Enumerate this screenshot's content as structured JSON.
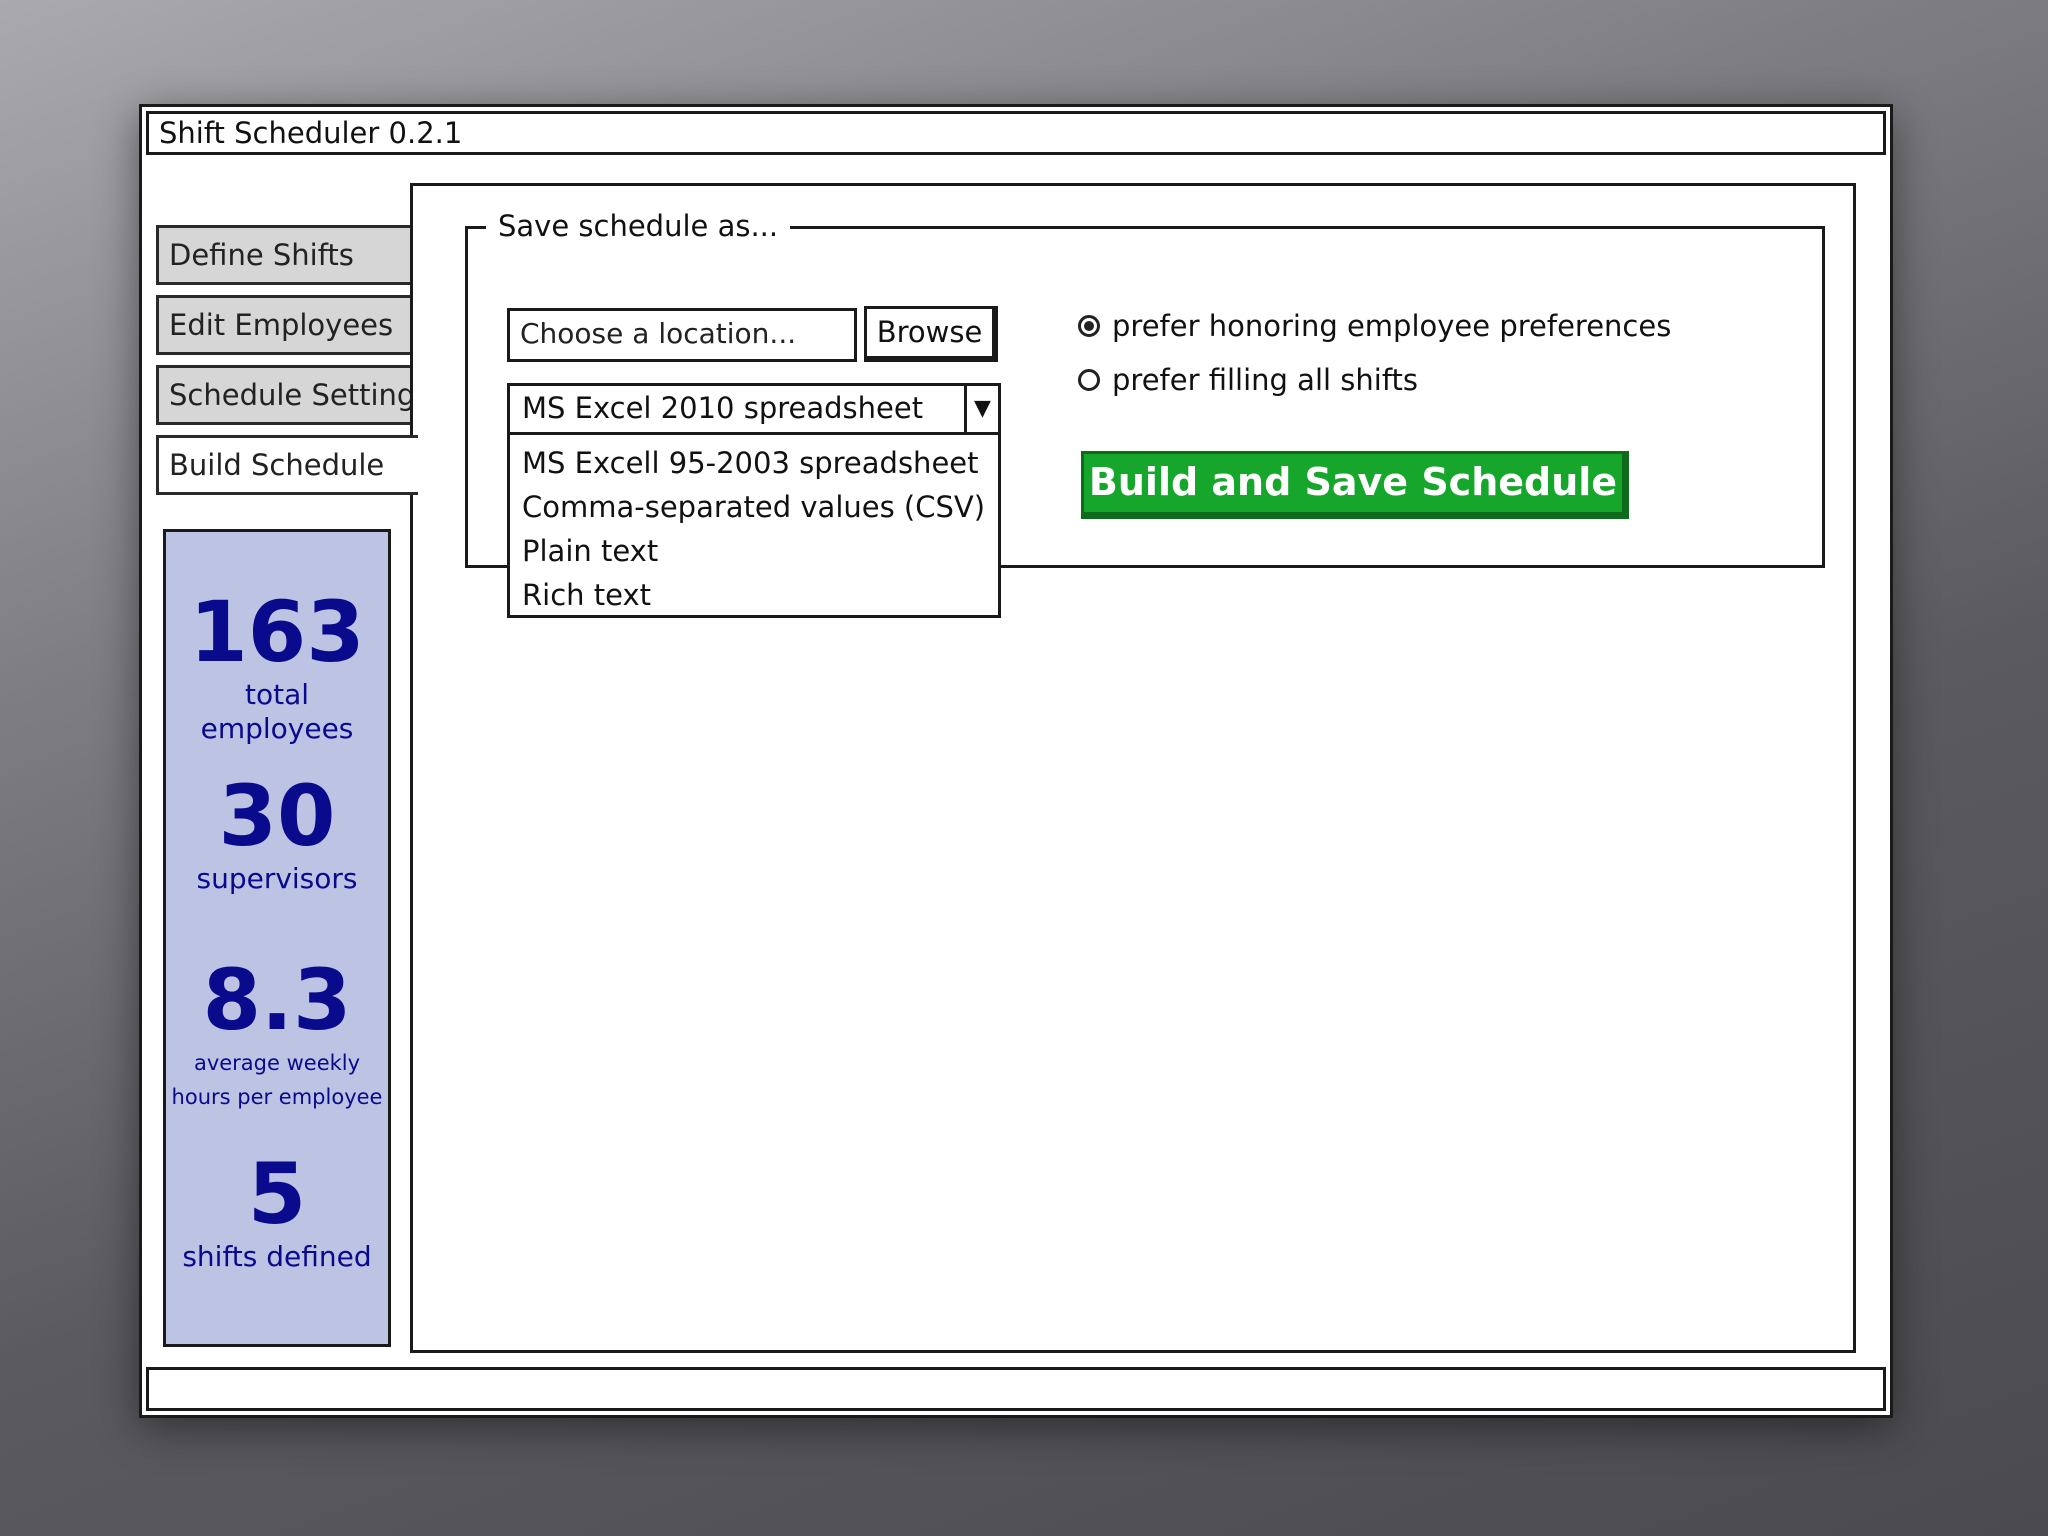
{
  "window": {
    "title": "Shift Scheduler 0.2.1"
  },
  "tabs": [
    {
      "label": "Define Shifts"
    },
    {
      "label": "Edit Employees"
    },
    {
      "label": "Schedule Settings"
    },
    {
      "label": "Build Schedule",
      "active": true
    }
  ],
  "save_panel": {
    "legend": "Save schedule as...",
    "location_placeholder": "Choose a location...",
    "browse_label": "Browse",
    "format_selected": "MS Excel 2010 spreadsheet",
    "format_options": [
      "MS Excell 95-2003 spreadsheet",
      "Comma-separated values (CSV)",
      "Plain text",
      "Rich text"
    ],
    "radio_options": [
      {
        "label": "prefer honoring employee preferences",
        "checked": true
      },
      {
        "label": "prefer filling all shifts",
        "checked": false
      }
    ],
    "build_button_label": "Build and Save Schedule"
  },
  "stats": {
    "total_employees": {
      "value": "163",
      "label": "total employees"
    },
    "supervisors": {
      "value": "30",
      "label": "supervisors"
    },
    "avg_hours": {
      "value": "8.3",
      "label_line1": "average weekly",
      "label_line2": "hours per employee"
    },
    "shifts": {
      "value": "5",
      "label": "shifts defined"
    }
  },
  "colors": {
    "build_button": "#17a62c",
    "stats_panel_bg": "#bcc3e3",
    "stats_text": "#0a0a8c"
  },
  "icons": {
    "dropdown_arrow": "chevron-down-icon",
    "radio_selected": "radio-checked-icon",
    "radio_unselected": "radio-unchecked-icon"
  }
}
